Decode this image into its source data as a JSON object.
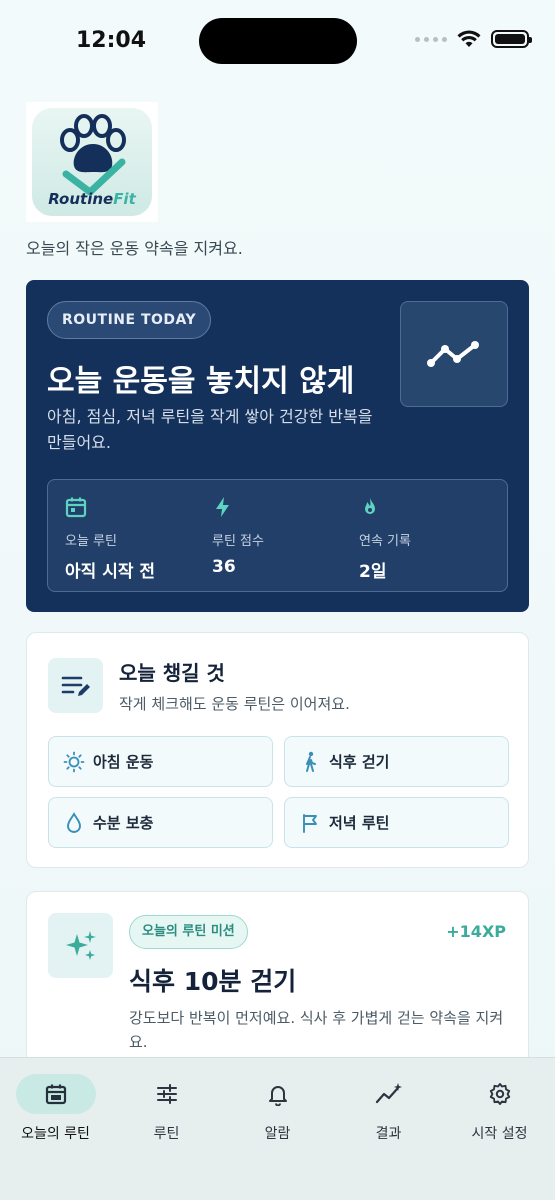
{
  "status_bar": {
    "time": "12:04"
  },
  "app": {
    "logo_text_part1": "Routine",
    "logo_text_part2": "Fit",
    "tagline": "오늘의 작은 운동 약속을 지켜요."
  },
  "hero": {
    "badge": "ROUTINE TODAY",
    "title": "오늘 운동을 놓치지 않게",
    "description": "아침, 점심, 저녁 루틴을 작게 쌓아 건강한 반복을 만들어요.",
    "stats": [
      {
        "icon": "calendar-icon",
        "label": "오늘 루틴",
        "value": "아직 시작 전"
      },
      {
        "icon": "bolt-icon",
        "label": "루틴 점수",
        "value": "36"
      },
      {
        "icon": "flame-icon",
        "label": "연속 기록",
        "value": "2일"
      }
    ]
  },
  "checklist": {
    "title": "오늘 챙길 것",
    "subtitle": "작게 체크해도 운동 루틴은 이어져요.",
    "items": [
      {
        "icon": "sun-icon",
        "label": "아침 운동"
      },
      {
        "icon": "walking-icon",
        "label": "식후 걷기"
      },
      {
        "icon": "water-drop-icon",
        "label": "수분 보충"
      },
      {
        "icon": "flag-icon",
        "label": "저녁 루틴"
      }
    ]
  },
  "mission": {
    "badge": "오늘의 루틴 미션",
    "xp": "+14XP",
    "title": "식후 10분 걷기",
    "description": "강도보다 반복이 먼저예요. 식사 후 가볍게 걷는 약속을 지켜요."
  },
  "nav": {
    "active_index": 0,
    "items": [
      {
        "icon": "calendar-icon",
        "label": "오늘의 루틴"
      },
      {
        "icon": "sliders-icon",
        "label": "루틴"
      },
      {
        "icon": "bell-icon",
        "label": "알람"
      },
      {
        "icon": "trend-sparkle-icon",
        "label": "결과"
      },
      {
        "icon": "gear-icon",
        "label": "시작 설정"
      }
    ]
  },
  "colors": {
    "hero_bg": "#14315c",
    "accent_teal": "#3bab9b",
    "nav_active_bg": "#c9e9e5"
  }
}
